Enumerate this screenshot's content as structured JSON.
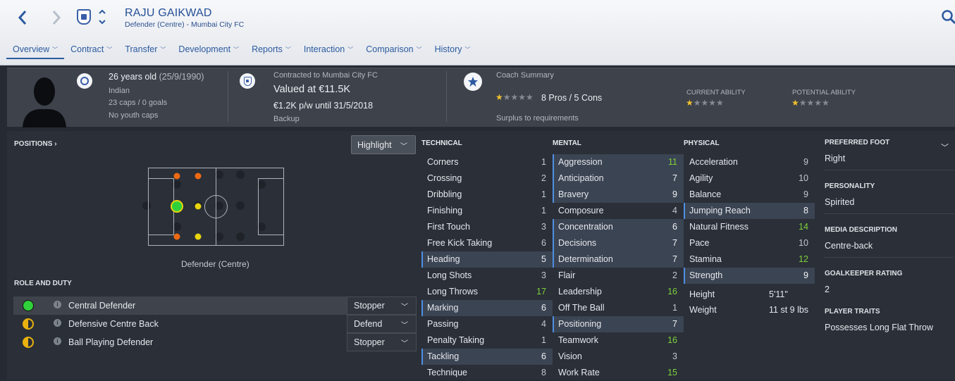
{
  "header": {
    "name": "RAJU GAIKWAD",
    "subtitle": "Defender (Centre) - Mumbai City FC"
  },
  "tabs": [
    "Overview",
    "Contract",
    "Transfer",
    "Development",
    "Reports",
    "Interaction",
    "Comparison",
    "History"
  ],
  "summary": {
    "age": "26 years old",
    "dob": "(25/9/1990)",
    "nationality": "Indian",
    "caps": "23 caps / 0 goals",
    "youth": "No youth caps",
    "contract": "Contracted to Mumbai City FC",
    "value": "Valued at €11.5K",
    "wage": "€1.2K p/w until 31/5/2018",
    "status": "Backup",
    "coach_label": "Coach Summary",
    "pros_cons": "8 Pros / 5 Cons",
    "coach_stars": 1,
    "surplus": "Surplus to requirements",
    "ca_label": "CURRENT ABILITY",
    "pa_label": "POTENTIAL ABILITY",
    "ca_stars": 1,
    "pa_stars": 1
  },
  "positions": {
    "label": "POSITIONS",
    "highlight": "Highlight",
    "position_text": "Defender (Centre)"
  },
  "roles": {
    "label": "ROLE AND DUTY",
    "items": [
      {
        "name": "Central Defender",
        "duty": "Stopper",
        "color": "#2fd13a"
      },
      {
        "name": "Defensive Centre Back",
        "duty": "Defend",
        "color": "half"
      },
      {
        "name": "Ball Playing Defender",
        "duty": "Stopper",
        "color": "half"
      }
    ]
  },
  "technical": {
    "label": "TECHNICAL",
    "items": [
      {
        "name": "Corners",
        "value": "1"
      },
      {
        "name": "Crossing",
        "value": "2"
      },
      {
        "name": "Dribbling",
        "value": "1"
      },
      {
        "name": "Finishing",
        "value": "1"
      },
      {
        "name": "First Touch",
        "value": "3"
      },
      {
        "name": "Free Kick Taking",
        "value": "6"
      },
      {
        "name": "Heading",
        "value": "5",
        "hi": true
      },
      {
        "name": "Long Shots",
        "value": "3"
      },
      {
        "name": "Long Throws",
        "value": "17",
        "g": true
      },
      {
        "name": "Marking",
        "value": "6",
        "hi": true
      },
      {
        "name": "Passing",
        "value": "4"
      },
      {
        "name": "Penalty Taking",
        "value": "1"
      },
      {
        "name": "Tackling",
        "value": "6",
        "hi": true
      },
      {
        "name": "Technique",
        "value": "8"
      }
    ]
  },
  "mental": {
    "label": "MENTAL",
    "items": [
      {
        "name": "Aggression",
        "value": "11",
        "hi": true,
        "g": true
      },
      {
        "name": "Anticipation",
        "value": "7",
        "hi": true
      },
      {
        "name": "Bravery",
        "value": "9",
        "hi": true
      },
      {
        "name": "Composure",
        "value": "4"
      },
      {
        "name": "Concentration",
        "value": "6",
        "hi": true
      },
      {
        "name": "Decisions",
        "value": "7",
        "hi": true
      },
      {
        "name": "Determination",
        "value": "7",
        "hi": true
      },
      {
        "name": "Flair",
        "value": "2"
      },
      {
        "name": "Leadership",
        "value": "16",
        "g": true
      },
      {
        "name": "Off The Ball",
        "value": "1"
      },
      {
        "name": "Positioning",
        "value": "7",
        "hi": true
      },
      {
        "name": "Teamwork",
        "value": "16",
        "g": true
      },
      {
        "name": "Vision",
        "value": "3"
      },
      {
        "name": "Work Rate",
        "value": "15",
        "g": true
      }
    ]
  },
  "physical": {
    "label": "PHYSICAL",
    "items": [
      {
        "name": "Acceleration",
        "value": "9"
      },
      {
        "name": "Agility",
        "value": "10"
      },
      {
        "name": "Balance",
        "value": "9"
      },
      {
        "name": "Jumping Reach",
        "value": "8",
        "hi": true
      },
      {
        "name": "Natural Fitness",
        "value": "14",
        "g": true
      },
      {
        "name": "Pace",
        "value": "10"
      },
      {
        "name": "Stamina",
        "value": "12",
        "g": true
      },
      {
        "name": "Strength",
        "value": "9",
        "hi": true
      }
    ],
    "height_label": "Height",
    "height": "5'11\"",
    "weight_label": "Weight",
    "weight": "11 st 9 lbs"
  },
  "info": [
    {
      "label": "PREFERRED FOOT",
      "value": "Right"
    },
    {
      "label": "PERSONALITY",
      "value": "Spirited"
    },
    {
      "label": "MEDIA DESCRIPTION",
      "value": "Centre-back"
    },
    {
      "label": "GOALKEEPER RATING",
      "value": "2"
    },
    {
      "label": "PLAYER TRAITS",
      "value": "Possesses Long Flat Throw"
    }
  ]
}
